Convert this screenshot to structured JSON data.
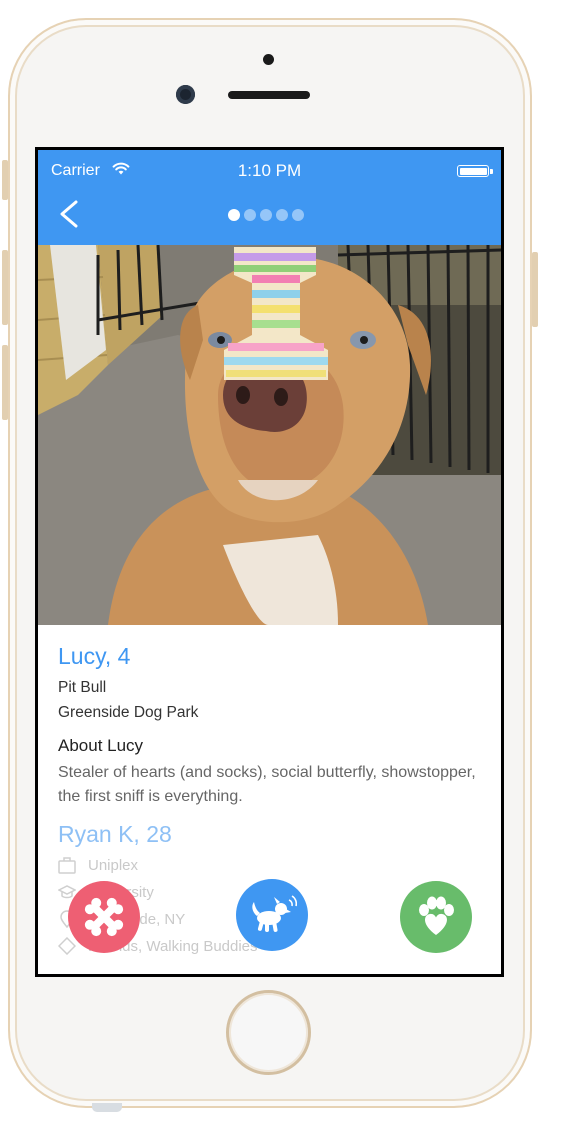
{
  "status_bar": {
    "carrier": "Carrier",
    "time": "1:10 PM"
  },
  "nav": {
    "back_icon": "chevron-left-icon",
    "page_dots": {
      "count": 5,
      "active_index": 0
    }
  },
  "photo": {
    "description_icon": "dog-photo"
  },
  "profile": {
    "name": "Lucy, 4",
    "breed": "Pit Bull",
    "location": "Greenside Dog Park",
    "about_heading": "About Lucy",
    "about_text": "Stealer of hearts (and socks),  social butterfly, showstopper, the first sniff is everything."
  },
  "owner": {
    "name": "Ryan K, 28",
    "work": "Uniplex",
    "school": "University",
    "neighborhood": "West Side, NY",
    "interests": "Friends, Walking Buddies"
  },
  "actions": {
    "dislike": {
      "icon": "crossed-bones-icon"
    },
    "woof": {
      "icon": "dog-icon"
    },
    "like": {
      "icon": "paw-heart-icon"
    }
  },
  "colors": {
    "brand_blue": "#3f97f2",
    "owner_blue": "#8ec0f5",
    "dislike_red": "#ee5f73",
    "like_green": "#68bc6b",
    "phone_gold": "#e6d2b4"
  }
}
